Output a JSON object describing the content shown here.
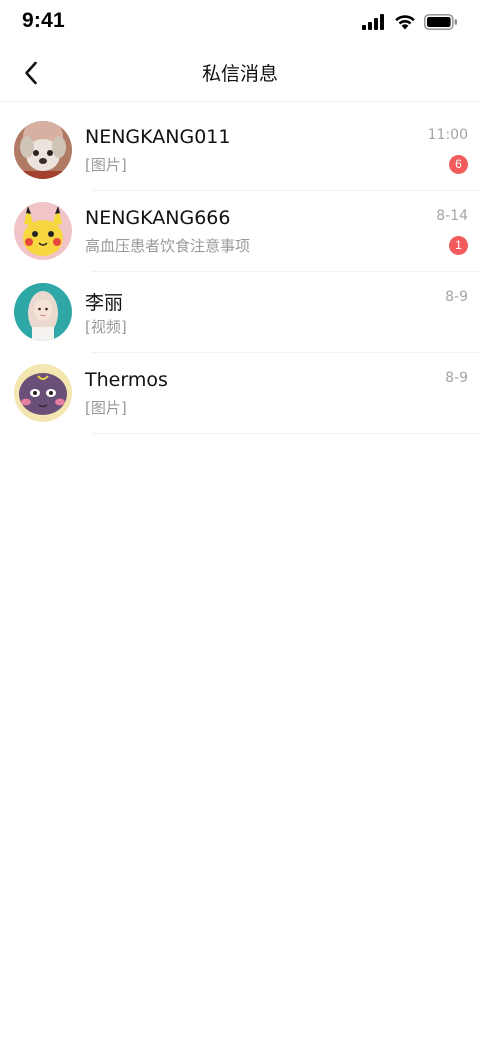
{
  "status_bar": {
    "time": "9:41",
    "icons": [
      "cellular-signal-icon",
      "wifi-icon",
      "battery-icon"
    ]
  },
  "nav": {
    "back_icon": "chevron-left-icon",
    "title": "私信消息"
  },
  "conversations": [
    {
      "name": "NENGKANG011",
      "preview": "[图片]",
      "time": "11:00",
      "unread": "6",
      "avatar": "puppy-avatar"
    },
    {
      "name": "NENGKANG666",
      "preview": "高血压患者饮食注意事项",
      "time": "8-14",
      "unread": "1",
      "avatar": "pikachu-avatar"
    },
    {
      "name": "李丽",
      "preview": "[视频]",
      "time": "8-9",
      "unread": "",
      "avatar": "woman-portrait-avatar"
    },
    {
      "name": "Thermos",
      "preview": "[图片]",
      "time": "8-9",
      "unread": "",
      "avatar": "purple-cartoon-avatar"
    }
  ],
  "colors": {
    "badge": "#f25c5c",
    "secondary_text": "#999999",
    "divider": "#f1f1f1"
  }
}
